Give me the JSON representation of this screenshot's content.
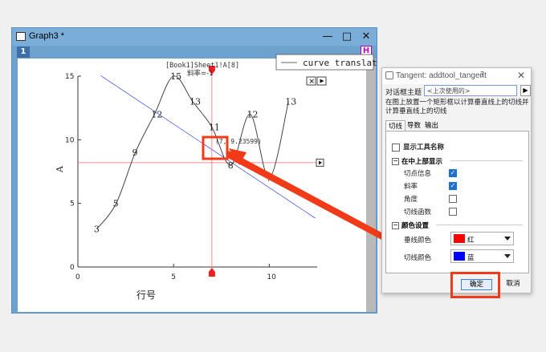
{
  "window": {
    "title": "Graph3 *",
    "layer_number": "1",
    "h_badge": "H",
    "minimize": "—",
    "maximize": "□",
    "close": "✕"
  },
  "graph": {
    "legend_text": "curve translat",
    "caption_line1": "[Book1]Sheet1!A[8]",
    "caption_line2": "斜率=-1",
    "tangent_label": "(7, 9.23599)",
    "xlabel": "行号",
    "ylabel": "A"
  },
  "chart_data": {
    "type": "line",
    "x": [
      1,
      2,
      3,
      4,
      5,
      6,
      7,
      8,
      9,
      10,
      11
    ],
    "values": [
      3,
      5,
      9,
      12,
      15,
      13,
      11,
      8,
      12,
      7,
      13
    ],
    "point_labels": [
      "3",
      "5",
      "9",
      "12",
      "15",
      "13",
      "11",
      "8",
      "12",
      "7",
      "13"
    ],
    "xlabel": "行号",
    "ylabel": "A",
    "xlim": [
      0,
      12.5
    ],
    "ylim": [
      0,
      15
    ],
    "xticks": [
      0,
      5,
      10
    ],
    "yticks": [
      0,
      5,
      10,
      15
    ],
    "tangent_point": [
      7,
      9.23599
    ],
    "tangent_slope": -1,
    "colors": {
      "curve": "#333333",
      "tangent": "#4a5ee0",
      "crosshair": "#ff6b6b"
    }
  },
  "dialog": {
    "title": "Tangent: addtool_tangent",
    "help": "?",
    "close": "✕",
    "theme_label": "对话框主题",
    "theme_value": "<上次使用的>",
    "theme_arrow": "▶",
    "description": "在图上放置一个矩形框以计算垂直线上的切线并计算垂直线上的切线",
    "tabs": [
      "切线",
      "导数",
      "输出"
    ],
    "show_tool_name": "显示工具名称",
    "section_top": "在中上部显示",
    "collapse_glyph": "−",
    "options": [
      {
        "label": "切点信息",
        "checked": true
      },
      {
        "label": "斜率",
        "checked": true
      },
      {
        "label": "角度",
        "checked": false
      },
      {
        "label": "切线函数",
        "checked": false
      }
    ],
    "section_color": "颜色设置",
    "vertical_color_label": "垂线颜色",
    "vertical_color_value": "红",
    "vertical_color_hex": "#ff0000",
    "tangent_color_label": "切线颜色",
    "tangent_color_value": "蓝",
    "tangent_color_hex": "#0000ff",
    "ok": "确定",
    "cancel": "取消"
  }
}
